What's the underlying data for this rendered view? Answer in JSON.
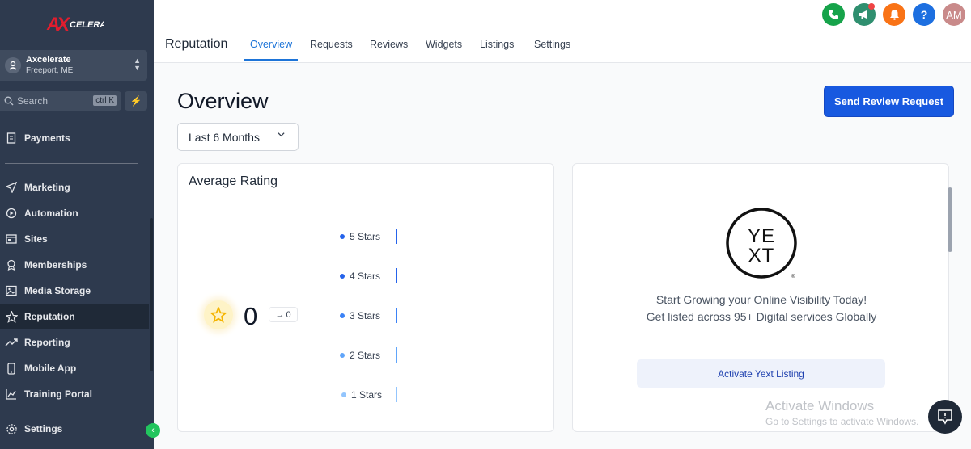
{
  "app": {
    "logo_text": "AXCELERATE"
  },
  "location": {
    "name": "Axcelerate",
    "city": "Freeport, ME"
  },
  "search": {
    "label": "Search",
    "shortcut": "ctrl K"
  },
  "sidebar": {
    "items": [
      {
        "label": "Payments",
        "icon": "receipt-icon"
      },
      {
        "label": "Marketing",
        "icon": "send-icon"
      },
      {
        "label": "Automation",
        "icon": "automation-icon"
      },
      {
        "label": "Sites",
        "icon": "sites-icon"
      },
      {
        "label": "Memberships",
        "icon": "award-icon"
      },
      {
        "label": "Media Storage",
        "icon": "image-icon"
      },
      {
        "label": "Reputation",
        "icon": "star-icon"
      },
      {
        "label": "Reporting",
        "icon": "trend-icon"
      },
      {
        "label": "Mobile App",
        "icon": "phone-icon"
      },
      {
        "label": "Training Portal",
        "icon": "chart-icon"
      },
      {
        "label": "Settings",
        "icon": "gear-icon"
      }
    ]
  },
  "header": {
    "title": "Reputation",
    "tabs": [
      {
        "label": "Overview"
      },
      {
        "label": "Requests"
      },
      {
        "label": "Reviews"
      },
      {
        "label": "Widgets"
      },
      {
        "label": "Listings"
      },
      {
        "label": "Settings"
      }
    ],
    "avatar_initials": "AM",
    "help_label": "?"
  },
  "main": {
    "title": "Overview",
    "send_button": "Send Review Request",
    "date_filter": "Last 6 Months"
  },
  "rating_card": {
    "title": "Average Rating",
    "value": "0",
    "delta": "0",
    "rows": [
      {
        "label": "5 Stars",
        "color": "#2563eb"
      },
      {
        "label": "4 Stars",
        "color": "#2563eb"
      },
      {
        "label": "3 Stars",
        "color": "#3b82f6"
      },
      {
        "label": "2 Stars",
        "color": "#60a5fa"
      },
      {
        "label": "1 Stars",
        "color": "#93c5fd"
      }
    ]
  },
  "yext_card": {
    "logo_line1": "YE",
    "logo_line2": "XT",
    "line1": "Start Growing your Online Visibility Today!",
    "line2": "Get listed across 95+ Digital services Globally",
    "button": "Activate Yext Listing"
  },
  "watermark": {
    "line1": "Activate Windows",
    "line2": "Go to Settings to activate Windows."
  },
  "colors": {
    "sidebar_bg": "#2e3a4e",
    "accent": "#1859e0",
    "tab_active": "#1d74d8",
    "phone": "#16a34a",
    "megaphone": "#2f8f6f",
    "bell": "#f97316",
    "help": "#1d6fe0",
    "avatar": "#c98a8a"
  }
}
